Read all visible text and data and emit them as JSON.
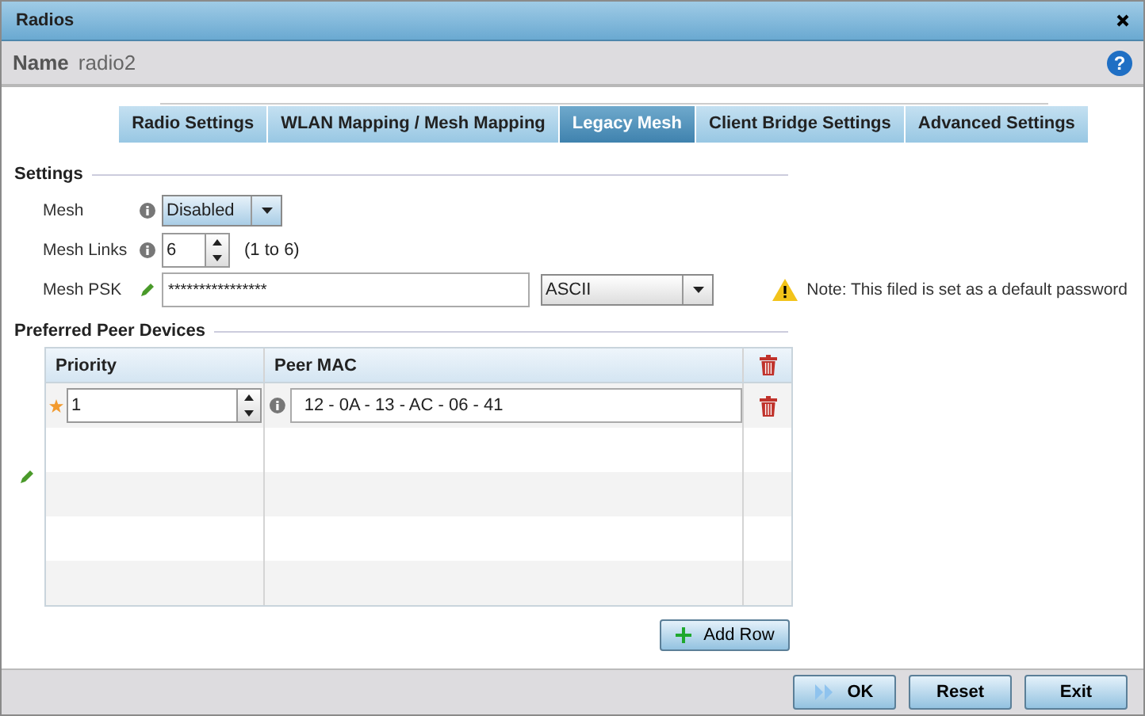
{
  "window": {
    "title": "Radios"
  },
  "name": {
    "label": "Name",
    "value": "radio2",
    "help": "?"
  },
  "tabs": [
    {
      "label": "Radio Settings",
      "selected": false
    },
    {
      "label": "WLAN Mapping / Mesh Mapping",
      "selected": false
    },
    {
      "label": "Legacy Mesh",
      "selected": true
    },
    {
      "label": "Client Bridge Settings",
      "selected": false
    },
    {
      "label": "Advanced Settings",
      "selected": false
    }
  ],
  "settings": {
    "title": "Settings",
    "mesh": {
      "label": "Mesh",
      "value": "Disabled"
    },
    "mesh_links": {
      "label": "Mesh Links",
      "value": "6",
      "range": "(1 to 6)"
    },
    "mesh_psk": {
      "label": "Mesh PSK",
      "value": "****************",
      "encoding": "ASCII"
    },
    "note": "Note: This filed is set as a default password"
  },
  "peers": {
    "title": "Preferred Peer Devices",
    "columns": [
      "Priority",
      "Peer MAC"
    ],
    "rows": [
      {
        "priority": "1",
        "peer_mac": "12 - 0A - 13 - AC - 06 - 41"
      }
    ],
    "add_button": "Add Row"
  },
  "buttons": [
    {
      "label": "OK",
      "kind": "primary"
    },
    {
      "label": "Reset",
      "kind": "plain"
    },
    {
      "label": "Exit",
      "kind": "plain"
    }
  ]
}
